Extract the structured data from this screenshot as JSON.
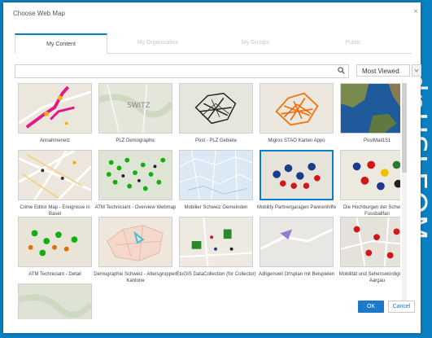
{
  "side_text": "dnHŞLEOM",
  "dialog": {
    "title": "Choose Web Map",
    "close_label": "×",
    "tabs": [
      {
        "label": "My Content",
        "active": true
      },
      {
        "label": "My Organization",
        "active": false
      },
      {
        "label": "My Groups",
        "active": false
      },
      {
        "label": "Public",
        "active": false
      }
    ],
    "search": {
      "value": "",
      "placeholder": "",
      "icon": "search-icon"
    },
    "sort": {
      "selected": "Most Viewed"
    },
    "items": [
      {
        "caption": "Annahmenetz",
        "theme": "magenta-route"
      },
      {
        "caption": "PLZ Demographic",
        "theme": "topo-plain"
      },
      {
        "caption": "Post - PLZ Gebiete",
        "theme": "black-network"
      },
      {
        "caption": "Migros STAO Karten Appo",
        "theme": "orange-network"
      },
      {
        "caption": "PostMail151",
        "theme": "world-imagery"
      },
      {
        "caption": "Crime Editor Map - Ereignisse in Basel",
        "theme": "basel-streets"
      },
      {
        "caption": "ATM Techniciant - Overview Webmap",
        "theme": "green-dots"
      },
      {
        "caption": "Mobilier Schweiz Gemeinden",
        "theme": "light-blue"
      },
      {
        "caption": "Mobility Partnergaragen Pannenhilfe",
        "theme": "bmw-markers"
      },
      {
        "caption": "Die Hochburgen der Schweizer Fussballfan",
        "theme": "football-logos"
      },
      {
        "caption": "ATM Techniciant - Detail",
        "theme": "atm-detail"
      },
      {
        "caption": "Demographie Schweiz - Altersgruppen Kantone",
        "theme": "pink-cantons"
      },
      {
        "caption": "EtoGIS DataCollection (for Collector)",
        "theme": "collector"
      },
      {
        "caption": "Adligenswil Ortsplan mit Beispielen",
        "theme": "adligenswil"
      },
      {
        "caption": "Mobilität und Sehenswürdigkeiten - Aargau",
        "theme": "red-pins"
      },
      {
        "caption": "",
        "theme": "topo-partial"
      }
    ],
    "selected_index": 8,
    "buttons": {
      "ok": "OK",
      "cancel": "Cancel"
    },
    "colors": {
      "accent": "#0a7fc2",
      "ok_button": "#1e78c8",
      "background": "#0a7fc2"
    }
  }
}
